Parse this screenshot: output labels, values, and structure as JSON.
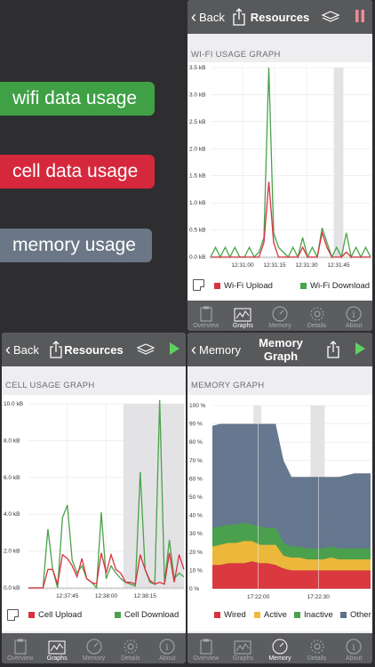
{
  "tags": {
    "wifi": "wifi data usage",
    "cell": "cell data usage",
    "memory": "memory usage"
  },
  "colors": {
    "green": "#4aa24a",
    "red": "#d93140",
    "slate": "#69788a",
    "bar": "#58595b",
    "orange": "#f4b93a",
    "blue": "#5d7189"
  },
  "wifi_screen": {
    "back": "Back",
    "title": "Resources",
    "section": "WI-FI USAGE GRAPH",
    "legend": [
      "Wi-Fi Upload",
      "Wi-Fi Download"
    ],
    "icons": [
      "share-icon",
      "layers-icon",
      "pause-icon"
    ]
  },
  "cell_screen": {
    "back": "Back",
    "title": "Resources",
    "section": "CELL USAGE GRAPH",
    "legend": [
      "Cell Upload",
      "Cell Download"
    ],
    "icons": [
      "share-icon",
      "layers-icon",
      "play-icon"
    ]
  },
  "memory_screen": {
    "back": "Memory",
    "title": "Memory Graph",
    "section": "MEMORY GRAPH",
    "legend": [
      "Wired",
      "Active",
      "Inactive",
      "Other"
    ],
    "icons": [
      "share-icon",
      "play-icon"
    ]
  },
  "tabs": [
    "Overview",
    "Graphs",
    "Memory",
    "Details",
    "About"
  ],
  "chart_data": [
    {
      "type": "line",
      "yticks": [
        "3.5 kB",
        "3.0 kB",
        "2.5 kB",
        "2.0 kB",
        "1.5 kB",
        "1.0 kB",
        "0.5 kB",
        "0.0 kB"
      ],
      "xticks": [
        "12:31:00",
        "12:31:15",
        "12:31:30",
        "12:31:45"
      ],
      "ylim": [
        0,
        3.9
      ],
      "series": [
        {
          "name": "Wi-Fi Upload",
          "values": [
            0,
            0,
            0,
            0,
            0,
            0,
            0,
            0,
            0,
            0,
            0,
            0.3,
            1.55,
            0.3,
            0,
            0,
            0,
            0,
            0,
            0.2,
            0,
            0,
            0,
            0.5,
            0.2,
            0,
            0,
            0,
            0.1,
            0,
            0,
            0,
            0,
            0
          ]
        },
        {
          "name": "Wi-Fi Download",
          "values": [
            0,
            0.2,
            0,
            0.2,
            0,
            0.2,
            0,
            0,
            0.2,
            0,
            0.1,
            0.4,
            3.9,
            0.5,
            0.2,
            0.1,
            0,
            0.2,
            0,
            0.4,
            0,
            0.2,
            0,
            0.6,
            0.3,
            0,
            0.2,
            0,
            0.5,
            0,
            0.2,
            0,
            0.2,
            0
          ]
        }
      ]
    },
    {
      "type": "line",
      "yticks": [
        "10.0 kB",
        "8.0 kB",
        "6.0 kB",
        "4.0 kB",
        "2.0 kB",
        "0.0 kB"
      ],
      "xticks": [
        "12:37:45",
        "12:38:00",
        "12:38:15"
      ],
      "ylim": [
        0,
        10
      ],
      "series": [
        {
          "name": "Cell Upload",
          "values": [
            0,
            0,
            0,
            0,
            1,
            1,
            0.2,
            1.8,
            1.6,
            1.2,
            0.6,
            1.6,
            0.5,
            0.3,
            0.2,
            1.9,
            0.8,
            1.8,
            1,
            0.8,
            0.3,
            0.3,
            0.2,
            1.8,
            1,
            0.4,
            0.2,
            0.3,
            0.2,
            1.9,
            0.3,
            1.8,
            1
          ]
        },
        {
          "name": "Cell Download",
          "values": [
            0,
            0,
            0,
            0,
            3.2,
            1,
            0,
            3.8,
            4.5,
            1.5,
            0.8,
            1.2,
            0.5,
            0.3,
            0,
            4.1,
            0.5,
            1.2,
            0.8,
            0.5,
            0.3,
            0.2,
            0.1,
            6.3,
            1,
            0.3,
            0.2,
            10.2,
            0.3,
            2.6,
            0.5,
            0.8,
            0.6
          ]
        }
      ]
    },
    {
      "type": "area",
      "yticks": [
        "100 %",
        "90 %",
        "80 %",
        "70 %",
        "60 %",
        "50 %",
        "40 %",
        "30 %",
        "20 %",
        "10 %",
        "0 %"
      ],
      "xticks": [
        "17:22:00",
        "17:22:30"
      ],
      "ylim": [
        0,
        100
      ],
      "series": [
        {
          "name": "Wired",
          "values": [
            13,
            13,
            14,
            14,
            14,
            15,
            14,
            14,
            13,
            11,
            10,
            10,
            10,
            10,
            10,
            10,
            10,
            10,
            10,
            10,
            10
          ]
        },
        {
          "name": "Active",
          "values": [
            23,
            24,
            25,
            25,
            26,
            26,
            24,
            24,
            24,
            18,
            17,
            17,
            16,
            16,
            16,
            17,
            16,
            16,
            16,
            16,
            16
          ]
        },
        {
          "name": "Inactive",
          "values": [
            33,
            34,
            35,
            35,
            36,
            35,
            34,
            33,
            33,
            25,
            23,
            23,
            22,
            22,
            22,
            23,
            22,
            22,
            22,
            22,
            22
          ]
        },
        {
          "name": "Other",
          "values": [
            89,
            90,
            90,
            90,
            90,
            90,
            90,
            90,
            90,
            70,
            61,
            61,
            61,
            61,
            61,
            61,
            61,
            62,
            63,
            63,
            63
          ]
        }
      ]
    }
  ]
}
